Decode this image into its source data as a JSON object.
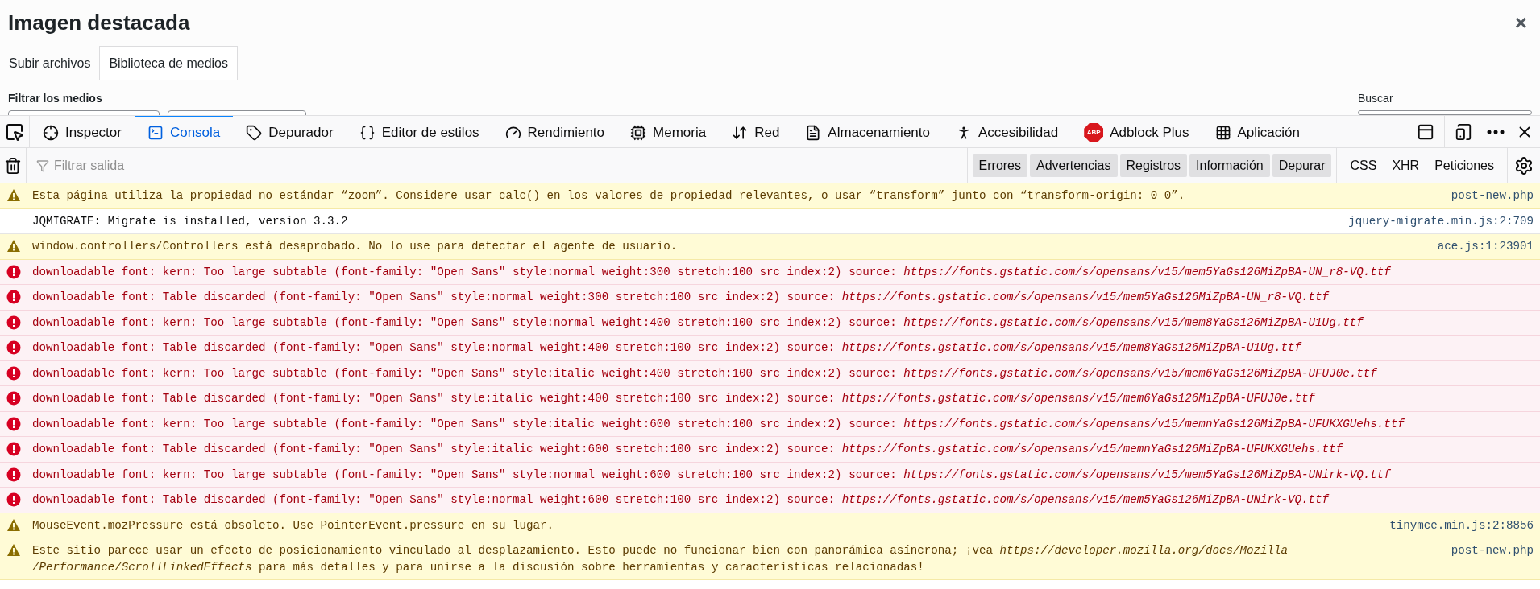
{
  "dialog": {
    "title": "Imagen destacada",
    "close": "×",
    "tabs": [
      {
        "label": "Subir archivos",
        "selected": false
      },
      {
        "label": "Biblioteca de medios",
        "selected": true
      }
    ],
    "filter_label": "Filtrar los medios",
    "search_label": "Buscar"
  },
  "devtools": {
    "tools": [
      {
        "label": "Inspector",
        "selected": false
      },
      {
        "label": "Consola",
        "selected": true
      },
      {
        "label": "Depurador",
        "selected": false
      },
      {
        "label": "Editor de estilos",
        "selected": false
      },
      {
        "label": "Rendimiento",
        "selected": false
      },
      {
        "label": "Memoria",
        "selected": false
      },
      {
        "label": "Red",
        "selected": false
      },
      {
        "label": "Almacenamiento",
        "selected": false
      },
      {
        "label": "Accesibilidad",
        "selected": false
      },
      {
        "label": "Adblock Plus",
        "badge": "ABP",
        "selected": false
      },
      {
        "label": "Aplicación",
        "selected": false
      }
    ],
    "filter": {
      "placeholder": "Filtrar salida"
    },
    "levels": [
      {
        "label": "Errores",
        "selected": true
      },
      {
        "label": "Advertencias",
        "selected": true
      },
      {
        "label": "Registros",
        "selected": true
      },
      {
        "label": "Información",
        "selected": true
      },
      {
        "label": "Depurar",
        "selected": true
      }
    ],
    "types": [
      {
        "label": "CSS",
        "selected": false
      },
      {
        "label": "XHR",
        "selected": false
      },
      {
        "label": "Peticiones",
        "selected": false
      }
    ],
    "messages": [
      {
        "kind": "warning",
        "lines": [
          "Esta página utiliza la propiedad no estándar “zoom”. Considere usar calc() en los valores de propiedad relevantes, o usar “transform” junto con “transform-origin: 0 0”."
        ],
        "source": "post-new.php"
      },
      {
        "kind": "log",
        "lines": [
          "JQMIGRATE: Migrate is installed, version 3.3.2"
        ],
        "source": "jquery-migrate.min.js:2:709"
      },
      {
        "kind": "warning",
        "lines": [
          "window.controllers/Controllers está desaprobado. No lo use para detectar el agente de usuario."
        ],
        "source": "ace.js:1:23901"
      },
      {
        "kind": "error",
        "lines": [
          "downloadable font: kern: Too large subtable (font-family: \"Open Sans\" style:normal weight:300 stretch:100 src index:2) source: *https://fonts.gstatic.com/s/opensans/v15/mem5YaGs126MiZpBA-UN_r8-VQ.ttf*"
        ]
      },
      {
        "kind": "error",
        "lines": [
          "downloadable font: Table discarded (font-family: \"Open Sans\" style:normal weight:300 stretch:100 src index:2) source: *https://fonts.gstatic.com/s/opensans/v15/mem5YaGs126MiZpBA-UN_r8-VQ.ttf*"
        ]
      },
      {
        "kind": "error",
        "lines": [
          "downloadable font: kern: Too large subtable (font-family: \"Open Sans\" style:normal weight:400 stretch:100 src index:2) source: *https://fonts.gstatic.com/s/opensans/v15/mem8YaGs126MiZpBA-U1Ug.ttf*"
        ]
      },
      {
        "kind": "error",
        "lines": [
          "downloadable font: Table discarded (font-family: \"Open Sans\" style:normal weight:400 stretch:100 src index:2) source: *https://fonts.gstatic.com/s/opensans/v15/mem8YaGs126MiZpBA-U1Ug.ttf*"
        ]
      },
      {
        "kind": "error",
        "lines": [
          "downloadable font: kern: Too large subtable (font-family: \"Open Sans\" style:italic weight:400 stretch:100 src index:2) source: *https://fonts.gstatic.com/s/opensans/v15/mem6YaGs126MiZpBA-UFUJ0e.ttf*"
        ]
      },
      {
        "kind": "error",
        "lines": [
          "downloadable font: Table discarded (font-family: \"Open Sans\" style:italic weight:400 stretch:100 src index:2) source: *https://fonts.gstatic.com/s/opensans/v15/mem6YaGs126MiZpBA-UFUJ0e.ttf*"
        ]
      },
      {
        "kind": "error",
        "lines": [
          "downloadable font: kern: Too large subtable (font-family: \"Open Sans\" style:italic weight:600 stretch:100 src index:2) source: *https://fonts.gstatic.com/s/opensans/v15/memnYaGs126MiZpBA-UFUKXGUehs.ttf*"
        ]
      },
      {
        "kind": "error",
        "lines": [
          "downloadable font: Table discarded (font-family: \"Open Sans\" style:italic weight:600 stretch:100 src index:2) source: *https://fonts.gstatic.com/s/opensans/v15/memnYaGs126MiZpBA-UFUKXGUehs.ttf*"
        ]
      },
      {
        "kind": "error",
        "lines": [
          "downloadable font: kern: Too large subtable (font-family: \"Open Sans\" style:normal weight:600 stretch:100 src index:2) source: *https://fonts.gstatic.com/s/opensans/v15/mem5YaGs126MiZpBA-UNirk-VQ.ttf*"
        ]
      },
      {
        "kind": "error",
        "lines": [
          "downloadable font: Table discarded (font-family: \"Open Sans\" style:normal weight:600 stretch:100 src index:2) source: *https://fonts.gstatic.com/s/opensans/v15/mem5YaGs126MiZpBA-UNirk-VQ.ttf*"
        ]
      },
      {
        "kind": "warning",
        "lines": [
          "MouseEvent.mozPressure está obsoleto. Use PointerEvent.pressure en su lugar."
        ],
        "source": "tinymce.min.js:2:8856"
      },
      {
        "kind": "warning",
        "lines": [
          "Este sitio parece usar un efecto de posicionamiento vinculado al desplazamiento. Esto puede no funcionar bien con panorámica asíncrona; ¡vea *https://developer.mozilla.org/docs/Mozilla*",
          "*/Performance/ScrollLinkedEffects* para más detalles y para unirse a la discusión sobre herramientas y características relacionadas!"
        ],
        "source": "post-new.php"
      }
    ]
  }
}
